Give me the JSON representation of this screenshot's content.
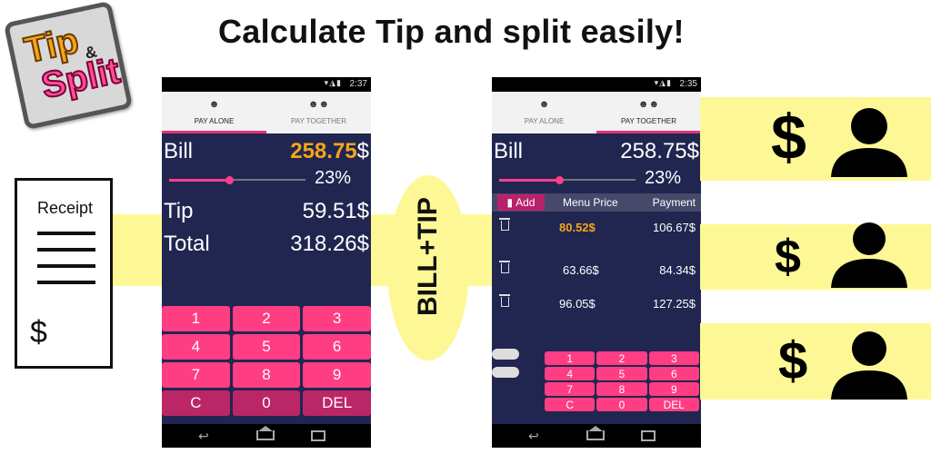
{
  "headline": "Calculate Tip and split easily!",
  "logo": {
    "line1": "Tip",
    "amp": "&",
    "line2": "Split"
  },
  "receipt": {
    "title": "Receipt",
    "currency": "$"
  },
  "bill_tip_label": "BILL+TIP",
  "phone1": {
    "status": {
      "icons": "▾◮▮",
      "time": "2:37"
    },
    "tabs": [
      {
        "icon": "user-icon",
        "label": "PAY ALONE",
        "active": true
      },
      {
        "icon": "group-icon",
        "label": "PAY TOGETHER",
        "active": false
      }
    ],
    "bill_label": "Bill",
    "bill_value": "258.75",
    "bill_currency": "$",
    "tip_percent": "23%",
    "tip_label": "Tip",
    "tip_value": "59.51$",
    "total_label": "Total",
    "total_value": "318.26$",
    "keypad": [
      "1",
      "2",
      "3",
      "4",
      "5",
      "6",
      "7",
      "8",
      "9",
      "C",
      "0",
      "DEL"
    ]
  },
  "phone2": {
    "status": {
      "icons": "▾◮▮",
      "time": "2:35"
    },
    "tabs": [
      {
        "icon": "user-icon",
        "label": "PAY ALONE",
        "active": false
      },
      {
        "icon": "group-icon",
        "label": "PAY TOGETHER",
        "active": true
      }
    ],
    "bill_label": "Bill",
    "bill_value": "258.75$",
    "tip_percent": "23%",
    "table": {
      "add_label": "Add",
      "col_price": "Menu Price",
      "col_payment": "Payment",
      "rows": [
        {
          "price": "80.52$",
          "payment": "106.67$",
          "selected": true
        },
        {
          "price": "63.66$",
          "payment": "84.34$",
          "selected": false
        },
        {
          "price": "96.05$",
          "payment": "127.25$",
          "selected": false
        }
      ]
    },
    "keypad": [
      "1",
      "2",
      "3",
      "4",
      "5",
      "6",
      "7",
      "8",
      "9",
      "C",
      "0",
      "DEL"
    ]
  },
  "people": [
    {
      "currency": "$"
    },
    {
      "currency": "$"
    },
    {
      "currency": "$"
    }
  ],
  "colors": {
    "accent": "#ff3d83",
    "highlight": "#fdf895",
    "screen": "#202650",
    "orange": "#f6a51a"
  }
}
